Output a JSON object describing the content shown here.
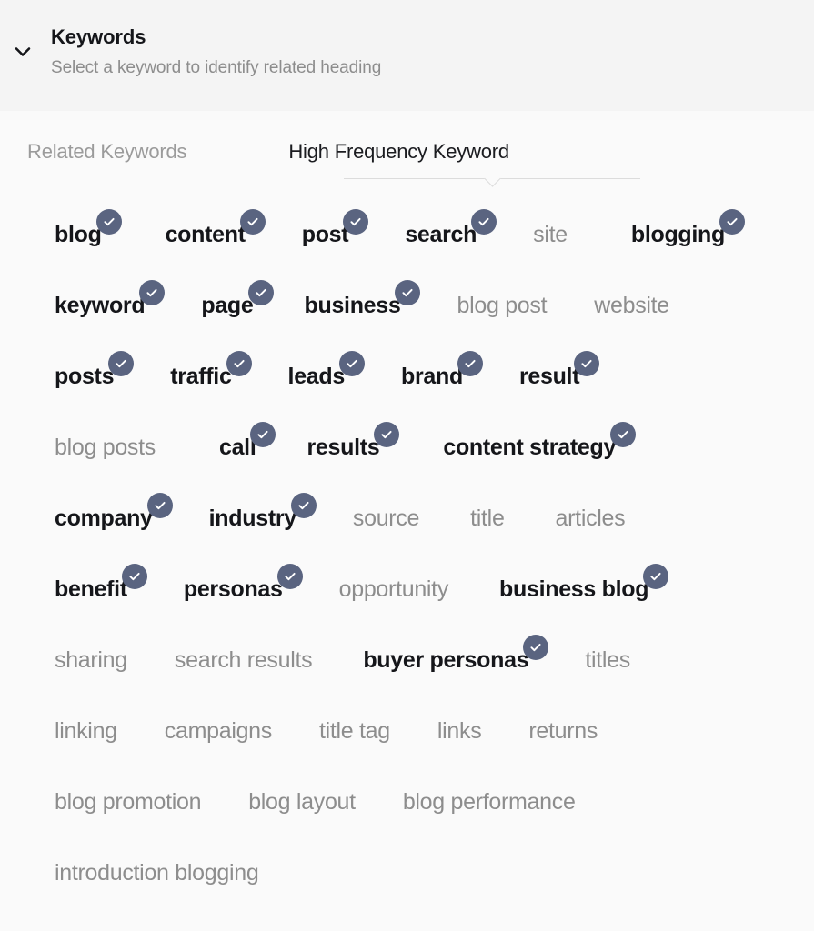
{
  "header": {
    "title": "Keywords",
    "subtitle": "Select a keyword to identify related heading",
    "toggle_icon": "chevron-down-icon"
  },
  "tabs": [
    {
      "label": "Related Keywords",
      "active": false
    },
    {
      "label": "High Frequency Keyword",
      "active": true
    }
  ],
  "colors": {
    "badge": "#5a6480",
    "selected_text": "#15161a",
    "unselected_text": "#8d8d8d",
    "header_bg": "#f4f4f4",
    "body_bg": "#fafafa",
    "underline": "#dcdcdc"
  },
  "badge_icon": "check-icon",
  "keyword_rows": [
    [
      {
        "label": "blog",
        "selected": true
      },
      {
        "label": "content",
        "selected": true
      },
      {
        "label": "post",
        "selected": true
      },
      {
        "label": "search",
        "selected": true
      },
      {
        "label": "site",
        "selected": false
      },
      {
        "label": "blogging",
        "selected": true
      }
    ],
    [
      {
        "label": "keyword",
        "selected": true
      },
      {
        "label": "page",
        "selected": true
      },
      {
        "label": "business",
        "selected": true
      },
      {
        "label": "blog post",
        "selected": false
      },
      {
        "label": "website",
        "selected": false
      }
    ],
    [
      {
        "label": "posts",
        "selected": true
      },
      {
        "label": "traffic",
        "selected": true
      },
      {
        "label": "leads",
        "selected": true
      },
      {
        "label": "brand",
        "selected": true
      },
      {
        "label": "result",
        "selected": true
      }
    ],
    [
      {
        "label": "blog posts",
        "selected": false
      },
      {
        "label": "call",
        "selected": true
      },
      {
        "label": "results",
        "selected": true
      },
      {
        "label": "content strategy",
        "selected": true
      }
    ],
    [
      {
        "label": "company",
        "selected": true
      },
      {
        "label": "industry",
        "selected": true
      },
      {
        "label": "source",
        "selected": false
      },
      {
        "label": "title",
        "selected": false
      },
      {
        "label": "articles",
        "selected": false
      }
    ],
    [
      {
        "label": "benefit",
        "selected": true
      },
      {
        "label": "personas",
        "selected": true
      },
      {
        "label": "opportunity",
        "selected": false
      },
      {
        "label": "business blog",
        "selected": true
      }
    ],
    [
      {
        "label": "sharing",
        "selected": false
      },
      {
        "label": "search results",
        "selected": false
      },
      {
        "label": "buyer personas",
        "selected": true
      },
      {
        "label": "titles",
        "selected": false
      }
    ],
    [
      {
        "label": "linking",
        "selected": false
      },
      {
        "label": "campaigns",
        "selected": false
      },
      {
        "label": "title tag",
        "selected": false
      },
      {
        "label": "links",
        "selected": false
      },
      {
        "label": "returns",
        "selected": false
      }
    ],
    [
      {
        "label": "blog promotion",
        "selected": false
      },
      {
        "label": "blog layout",
        "selected": false
      },
      {
        "label": "blog performance",
        "selected": false
      }
    ],
    [
      {
        "label": "introduction blogging",
        "selected": false
      }
    ]
  ]
}
